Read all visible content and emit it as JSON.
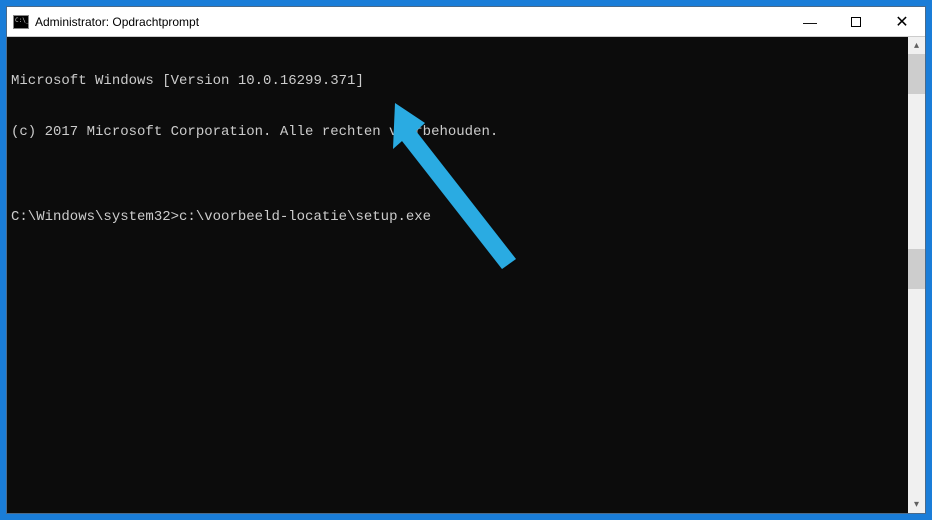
{
  "titlebar": {
    "title": "Administrator: Opdrachtprompt",
    "minimize": "—",
    "close": "✕"
  },
  "console": {
    "line1": "Microsoft Windows [Version 10.0.16299.371]",
    "line2": "(c) 2017 Microsoft Corporation. Alle rechten voorbehouden.",
    "blank": "",
    "prompt": "C:\\Windows\\system32>",
    "command": "c:\\voorbeeld-locatie\\setup.exe"
  },
  "scrollbar": {
    "up": "▴",
    "down": "▾"
  }
}
